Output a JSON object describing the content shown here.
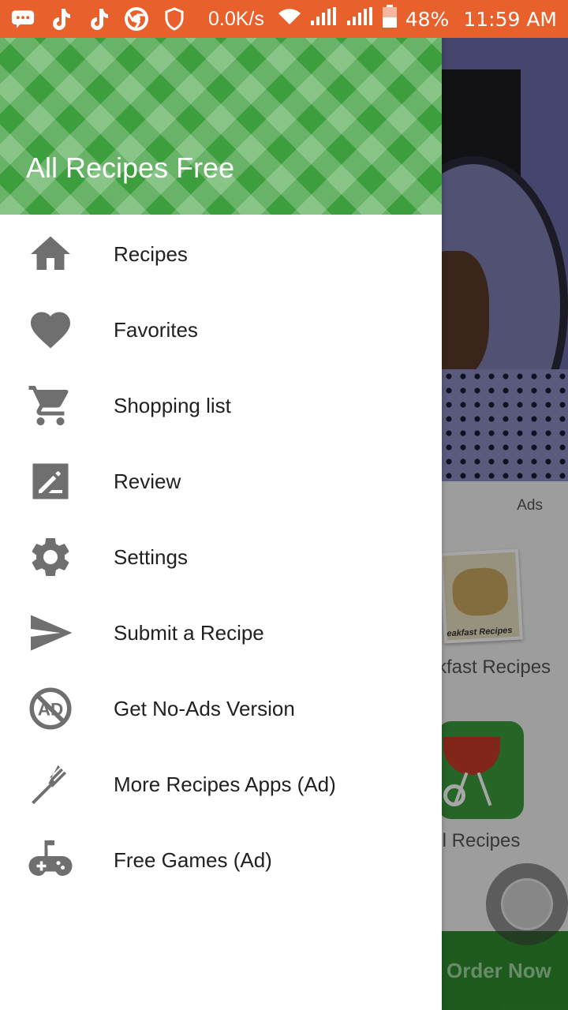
{
  "status_bar": {
    "speed": "0.0K/s",
    "battery": "48%",
    "time": "11:59 AM",
    "icons": [
      "message-icon",
      "tiktok-icon",
      "tiktok-icon",
      "chrome-icon",
      "shield-icon",
      "wifi-icon",
      "signal-icon",
      "signal-icon",
      "battery-icon"
    ]
  },
  "drawer": {
    "title": "All Recipes Free",
    "items": [
      {
        "label": "Recipes",
        "icon": "home-icon"
      },
      {
        "label": "Favorites",
        "icon": "heart-icon"
      },
      {
        "label": "Shopping list",
        "icon": "cart-icon"
      },
      {
        "label": "Review",
        "icon": "edit-icon"
      },
      {
        "label": "Settings",
        "icon": "gear-icon"
      },
      {
        "label": "Submit a Recipe",
        "icon": "send-icon"
      },
      {
        "label": "Get No-Ads Version",
        "icon": "no-ads-icon"
      },
      {
        "label": "More Recipes Apps (Ad)",
        "icon": "fork-icon"
      },
      {
        "label": "Free Games (Ad)",
        "icon": "gamepad-icon"
      }
    ]
  },
  "background": {
    "ads_label": "Ads",
    "card_caption": "eakfast Recipes",
    "item1_label": "kfast Recipes",
    "item2_label": "ill Recipes",
    "order_button": "Order Now"
  },
  "colors": {
    "status_bar": "#e8602c",
    "header_green": "#3d9e3d",
    "icon_gray": "#6f6f6f"
  }
}
